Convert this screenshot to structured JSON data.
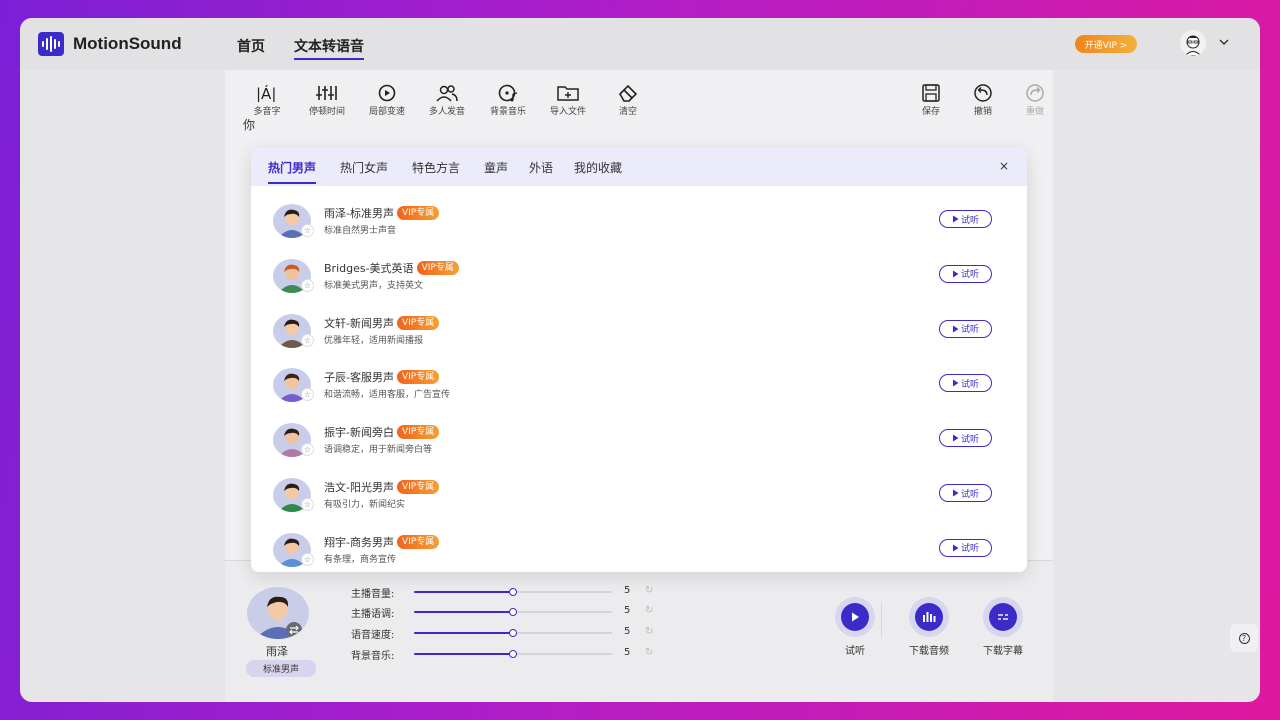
{
  "app": {
    "brand": "MotionSound",
    "vip_label": "开通VIP >",
    "accent": "#3b2cc9"
  },
  "nav": {
    "home": "首页",
    "tts": "文本转语音"
  },
  "toolbar": {
    "items": [
      {
        "label": "多音字",
        "icon": "polyphone-icon"
      },
      {
        "label": "停顿时间",
        "icon": "pause-time-icon"
      },
      {
        "label": "局部变速",
        "icon": "speed-icon"
      },
      {
        "label": "多人发音",
        "icon": "multi-speaker-icon"
      },
      {
        "label": "背景音乐",
        "icon": "music-icon"
      },
      {
        "label": "导入文件",
        "icon": "import-folder-icon"
      },
      {
        "label": "清空",
        "icon": "eraser-icon"
      }
    ],
    "save": "保存",
    "undo": "撤销",
    "redo": "重做"
  },
  "editor": {
    "peek_text": "你"
  },
  "modal": {
    "tabs": [
      "热门男声",
      "热门女声",
      "特色方言",
      "童声",
      "外语",
      "我的收藏"
    ],
    "active_tab": 0,
    "close": "×",
    "vip_badge": "VIP专属",
    "listen_label": "试听",
    "voices": [
      {
        "name": "雨泽-标准男声",
        "desc": "标准自然男士声音",
        "shirt": "#5b6fb8"
      },
      {
        "name": "Bridges-美式英语",
        "desc": "标准美式男声，支持英文",
        "shirt": "#3f8a52"
      },
      {
        "name": "文轩-新闻男声",
        "desc": "优雅年轻，适用新闻播报",
        "shirt": "#6e5a4a"
      },
      {
        "name": "子辰-客服男声",
        "desc": "和谐流畅，适用客服，广告宣传",
        "shirt": "#7a5bd0"
      },
      {
        "name": "振宇-新闻旁白",
        "desc": "语调稳定，用于新闻旁白等",
        "shirt": "#b07aa8"
      },
      {
        "name": "浩文-阳光男声",
        "desc": "有吸引力，新闻纪实",
        "shirt": "#2f8a48"
      },
      {
        "name": "翔宇-商务男声",
        "desc": "有条理，商务宣传",
        "shirt": "#5b8fd8"
      }
    ]
  },
  "speaker": {
    "name": "雨泽",
    "tag": "标准男声"
  },
  "sliders": [
    {
      "label": "主播音量:",
      "value": "5",
      "level": 0.5
    },
    {
      "label": "主播语调:",
      "value": "5",
      "level": 0.5
    },
    {
      "label": "语音速度:",
      "value": "5",
      "level": 0.5
    },
    {
      "label": "背景音乐:",
      "value": "5",
      "level": 0.5
    }
  ],
  "actions": {
    "listen": "试听",
    "download_audio": "下载音频",
    "download_subtitle": "下载字幕"
  },
  "help": "?"
}
